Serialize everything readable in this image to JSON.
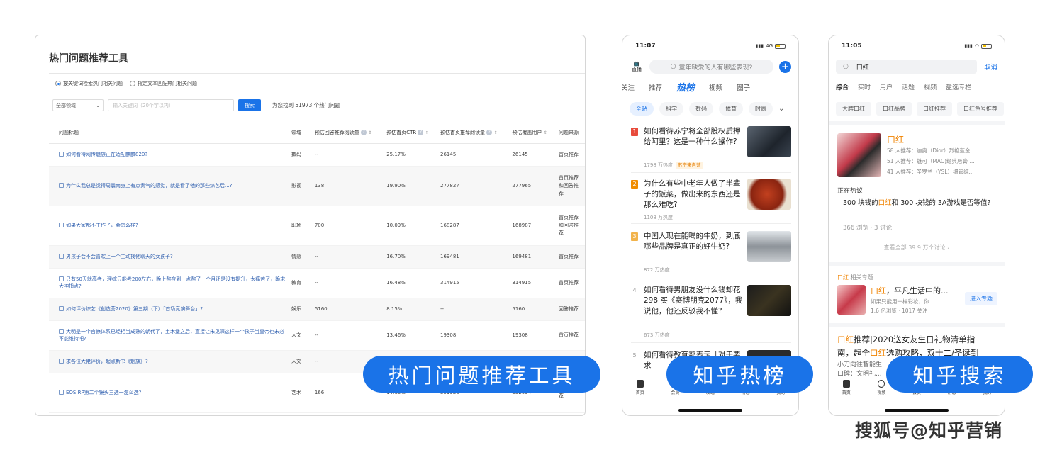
{
  "tool": {
    "title": "热门问题推荐工具",
    "radio1": "按关键词检索热门相关问题",
    "radio2": "指定文本匹配热门相关问题",
    "domain_select": "全部领域",
    "keyword_placeholder": "输入关键词（20个字以内）",
    "search_button": "搜索",
    "result_text": "为您找到 51973 个热门问题",
    "columns": [
      "问题标题",
      "领域",
      "预估回答推荐阅读量",
      "预估首页CTR",
      "预估首页推荐阅读量",
      "预估覆盖用户",
      "问题来源"
    ],
    "rows": [
      {
        "title": "如何看待网传魅族正在适配麒麟820?",
        "domain": "数码",
        "read": "--",
        "ctr": "25.17%",
        "home": "26145",
        "users": "26145",
        "source": "首页推荐"
      },
      {
        "title": "为什么我总是觉得周震南身上有点贵气的感觉，就是看了他的那些综艺后...?",
        "domain": "影视",
        "read": "138",
        "ctr": "19.90%",
        "home": "277827",
        "users": "277965",
        "source": "首页推荐和回答推荐"
      },
      {
        "title": "如果大家都不工作了，会怎么样?",
        "domain": "职场",
        "read": "700",
        "ctr": "10.09%",
        "home": "168287",
        "users": "168987",
        "source": "首页推荐和回答推荐"
      },
      {
        "title": "男孩子会不会喜欢上一个主动找他聊天的女孩子?",
        "domain": "情感",
        "read": "--",
        "ctr": "16.70%",
        "home": "169481",
        "users": "169481",
        "source": "首页推荐"
      },
      {
        "title": "只有50天就高考，理综只能考200左右，晚上熬夜到一点熬了一个月还是没有提升，太痛苦了，跪求大神指点?",
        "domain": "教育",
        "read": "--",
        "ctr": "16.48%",
        "home": "314915",
        "users": "314915",
        "source": "首页推荐"
      },
      {
        "title": "如何评价综艺《创造营2020》第三期（下）「首场竞演舞台」?",
        "domain": "娱乐",
        "read": "5160",
        "ctr": "8.15%",
        "home": "--",
        "users": "5160",
        "source": "回答推荐"
      },
      {
        "title": "大明是一个官僚体系已经相当成熟的朝代了，土木堡之后，直接让朱见深这样一个孩子当皇帝也未必不能维持吧?",
        "domain": "人文",
        "read": "--",
        "ctr": "13.46%",
        "home": "19308",
        "users": "19308",
        "source": "首页推荐"
      },
      {
        "title": "求各位大佬评价，起点新书《魍族》?",
        "domain": "人文",
        "read": "--",
        "ctr": "",
        "home": "",
        "users": "",
        "source": ""
      },
      {
        "title": "EOS RP第二个镜头三选一怎么选?",
        "domain": "艺术",
        "read": "166",
        "ctr": "14.16%",
        "home": "351926",
        "users": "352094",
        "source": "和回答推荐"
      }
    ]
  },
  "hot": {
    "time": "11:07",
    "signal": "4G",
    "live_label": "直播",
    "search_placeholder": "童年缺爱的人有哪些表现?",
    "tabs": [
      "关注",
      "推荐",
      "热榜",
      "视频",
      "圈子"
    ],
    "chips": [
      "全站",
      "科学",
      "数码",
      "体育",
      "时尚"
    ],
    "items": [
      {
        "rank": "1",
        "title": "如何看待苏宁将全部股权质押给阿里？这是一种什么操作?",
        "meta": "1798 万热度",
        "tag": "苏宁来自营"
      },
      {
        "rank": "2",
        "title": "为什么有些中老年人做了半辈子的饭菜，做出来的东西还是那么难吃?",
        "meta": "1108 万热度",
        "tag": ""
      },
      {
        "rank": "3",
        "title": "中国人现在能喝的牛奶，到底哪些品牌是真正的好牛奶?",
        "meta": "872 万热度",
        "tag": ""
      },
      {
        "rank": "4",
        "title": "如何看待男朋友没什么钱却花 298 买《赛博朋克2077》，我说他，他还反驳我不懂?",
        "meta": "673 万热度",
        "tag": ""
      },
      {
        "rank": "5",
        "title": "如何看待教育部表示「对于要求",
        "meta": "",
        "tag": ""
      }
    ],
    "tabbar": [
      "首页",
      "会员",
      "发现",
      "消息",
      "我的"
    ]
  },
  "search": {
    "time": "11:05",
    "query": "口红",
    "cancel": "取消",
    "tabs": [
      "综合",
      "实时",
      "用户",
      "话题",
      "视频",
      "盐选专栏"
    ],
    "chips": [
      "大牌口红",
      "口红品牌",
      "口红推荐",
      "口红色号推荐"
    ],
    "card_title": "口红",
    "recs": [
      "58 人推荐：迪奥（Dior）烈艳蓝金...",
      "51 人推荐：魅可（MAC)经典唇膏 ...",
      "41 人推荐：圣罗兰（YSL）细管纯..."
    ],
    "discuss_label": "正在热议",
    "discuss_pre": "300 块钱的",
    "discuss_kw": "口红",
    "discuss_post": "和 300 块钱的 3A游戏是否等值?",
    "discuss_meta": "366 浏览 · 3 讨论",
    "view_all": "查看全部 39.9 万个讨论 ›",
    "topic_kw": "口红",
    "topic_label": "相关专题",
    "topic_title_kw": "口红",
    "topic_title_rest": "，平凡生活中的...",
    "topic_desc": "如果只能用一样彩妆，你...",
    "topic_meta": "1.6 亿浏览 · 1017 关注",
    "enter_button": "进入专题",
    "article_kw": "口红",
    "article_l1_rest": "推荐|2020送女友生日礼物清单指",
    "article_l2_pre": "南，超全",
    "article_l2_kw": "口红",
    "article_l2_rest": "选购攻略，双十二/圣诞到",
    "article_l3": "小刀向往智能生",
    "article_l4": "口碑：文明礼...",
    "tabbar": [
      "首页",
      "视频",
      "会员",
      "消息",
      "我的"
    ]
  },
  "labels": {
    "tool": "热门问题推荐工具",
    "hot": "知乎热榜",
    "search": "知乎搜索"
  },
  "watermark": "搜狐号@知乎营销"
}
